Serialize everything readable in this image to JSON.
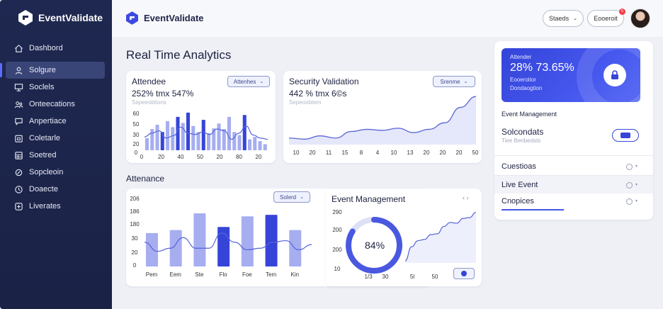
{
  "app": {
    "brand": "EventValidate"
  },
  "sidebar": {
    "items": [
      {
        "label": "Dashbord",
        "icon": "home-icon"
      },
      {
        "label": "Solgure",
        "icon": "user-icon"
      },
      {
        "label": "Soclels",
        "icon": "monitor-icon"
      },
      {
        "label": "Onteecations",
        "icon": "people-icon"
      },
      {
        "label": "Anpertiace",
        "icon": "chat-icon"
      },
      {
        "label": "Coletarle",
        "icon": "calendar-icon"
      },
      {
        "label": "Soetred",
        "icon": "grid-icon"
      },
      {
        "label": "Sopcleoin",
        "icon": "settings-icon"
      },
      {
        "label": "Doaecte",
        "icon": "clock-icon"
      },
      {
        "label": "Liverates",
        "icon": "plus-box-icon"
      }
    ],
    "active_index": 1
  },
  "topbar": {
    "brand": "EventValidate",
    "search_label": "Staeds",
    "account_label": "Eooeroit",
    "notif_count": "6"
  },
  "page": {
    "title": "Real Time Analytics"
  },
  "attendee_card": {
    "title": "Attendee",
    "value": "252% tmx 547%",
    "sub": "Sepeeobtions",
    "dropdown": "Attenhes"
  },
  "security_card": {
    "title": "Security Validation",
    "value": "442 % tmx 6©s",
    "sub": "Sepeoobtem",
    "dropdown": "Srenme"
  },
  "attenance": {
    "section": "Attenance",
    "dropdown": "Solerd"
  },
  "event_card": {
    "title": "Event Management",
    "donut_label": "84%"
  },
  "right_panel": {
    "hero_line1": "Attender",
    "hero_value": "28% 73.65%",
    "hero_line3": "Eooeroitor",
    "hero_line4": "Dondaogtion",
    "event_mgmt": "Event Management",
    "solcondats": "Solcondats",
    "solcondats_sub": "Tiee Benbedsts",
    "rows": [
      "Cuestioas",
      "Live Event",
      "Cnopices"
    ]
  },
  "chart_data": [
    {
      "type": "bar",
      "title": "Attendee",
      "categories": [
        "0",
        "20",
        "40",
        "50",
        "20",
        "80",
        "20"
      ],
      "y_ticks": [
        "20",
        "0",
        "30",
        "50",
        "60"
      ],
      "ylim": [
        0,
        70
      ],
      "series": [
        {
          "values": [
            20,
            35,
            42,
            30,
            48,
            38,
            55,
            45,
            62,
            40,
            30,
            50,
            28,
            36,
            44,
            35,
            55,
            30,
            25,
            58,
            18,
            22,
            15,
            10
          ]
        }
      ],
      "overlay_line": [
        22,
        28,
        32,
        20,
        24,
        38,
        28,
        26,
        30,
        26,
        35,
        32,
        18,
        28,
        40,
        25,
        20,
        18
      ],
      "grid": false
    },
    {
      "type": "area",
      "title": "Security Validation",
      "categories": [
        "10",
        "20",
        "11",
        "15",
        "8",
        "4",
        "10",
        "13",
        "20",
        "20",
        "20",
        "50"
      ],
      "values": [
        6,
        5,
        8,
        6,
        12,
        14,
        13,
        15,
        11,
        14,
        20,
        34,
        44
      ],
      "grid": false
    },
    {
      "type": "bar",
      "title": "Attenance",
      "categories": [
        "Pem",
        "Eem",
        "Ste",
        "Flo",
        "Foe",
        "Tem",
        "Kin"
      ],
      "y_ticks": [
        "206",
        "186",
        "180",
        "30",
        "20",
        "0"
      ],
      "ylim": [
        0,
        210
      ],
      "values": [
        110,
        120,
        175,
        130,
        165,
        170,
        120
      ],
      "overlay_line": [
        80,
        50,
        60,
        95,
        60,
        60,
        110,
        80,
        55,
        60,
        80,
        85,
        55,
        72
      ],
      "grid": false
    },
    {
      "type": "line",
      "title": "Event Management",
      "categories": [
        "1/3",
        "30",
        "5l",
        "50"
      ],
      "y_ticks": [
        "290",
        "200",
        "200",
        "10"
      ],
      "values": [
        5,
        40,
        55,
        58,
        70,
        72,
        90,
        100,
        98,
        110,
        112,
        125
      ],
      "donut_percent": 84,
      "grid": false
    }
  ],
  "colors": {
    "accent": "#4454e6",
    "bar_dark": "#3645d8",
    "bar_light": "#a6aef0",
    "sidebar": "#1f2850"
  }
}
